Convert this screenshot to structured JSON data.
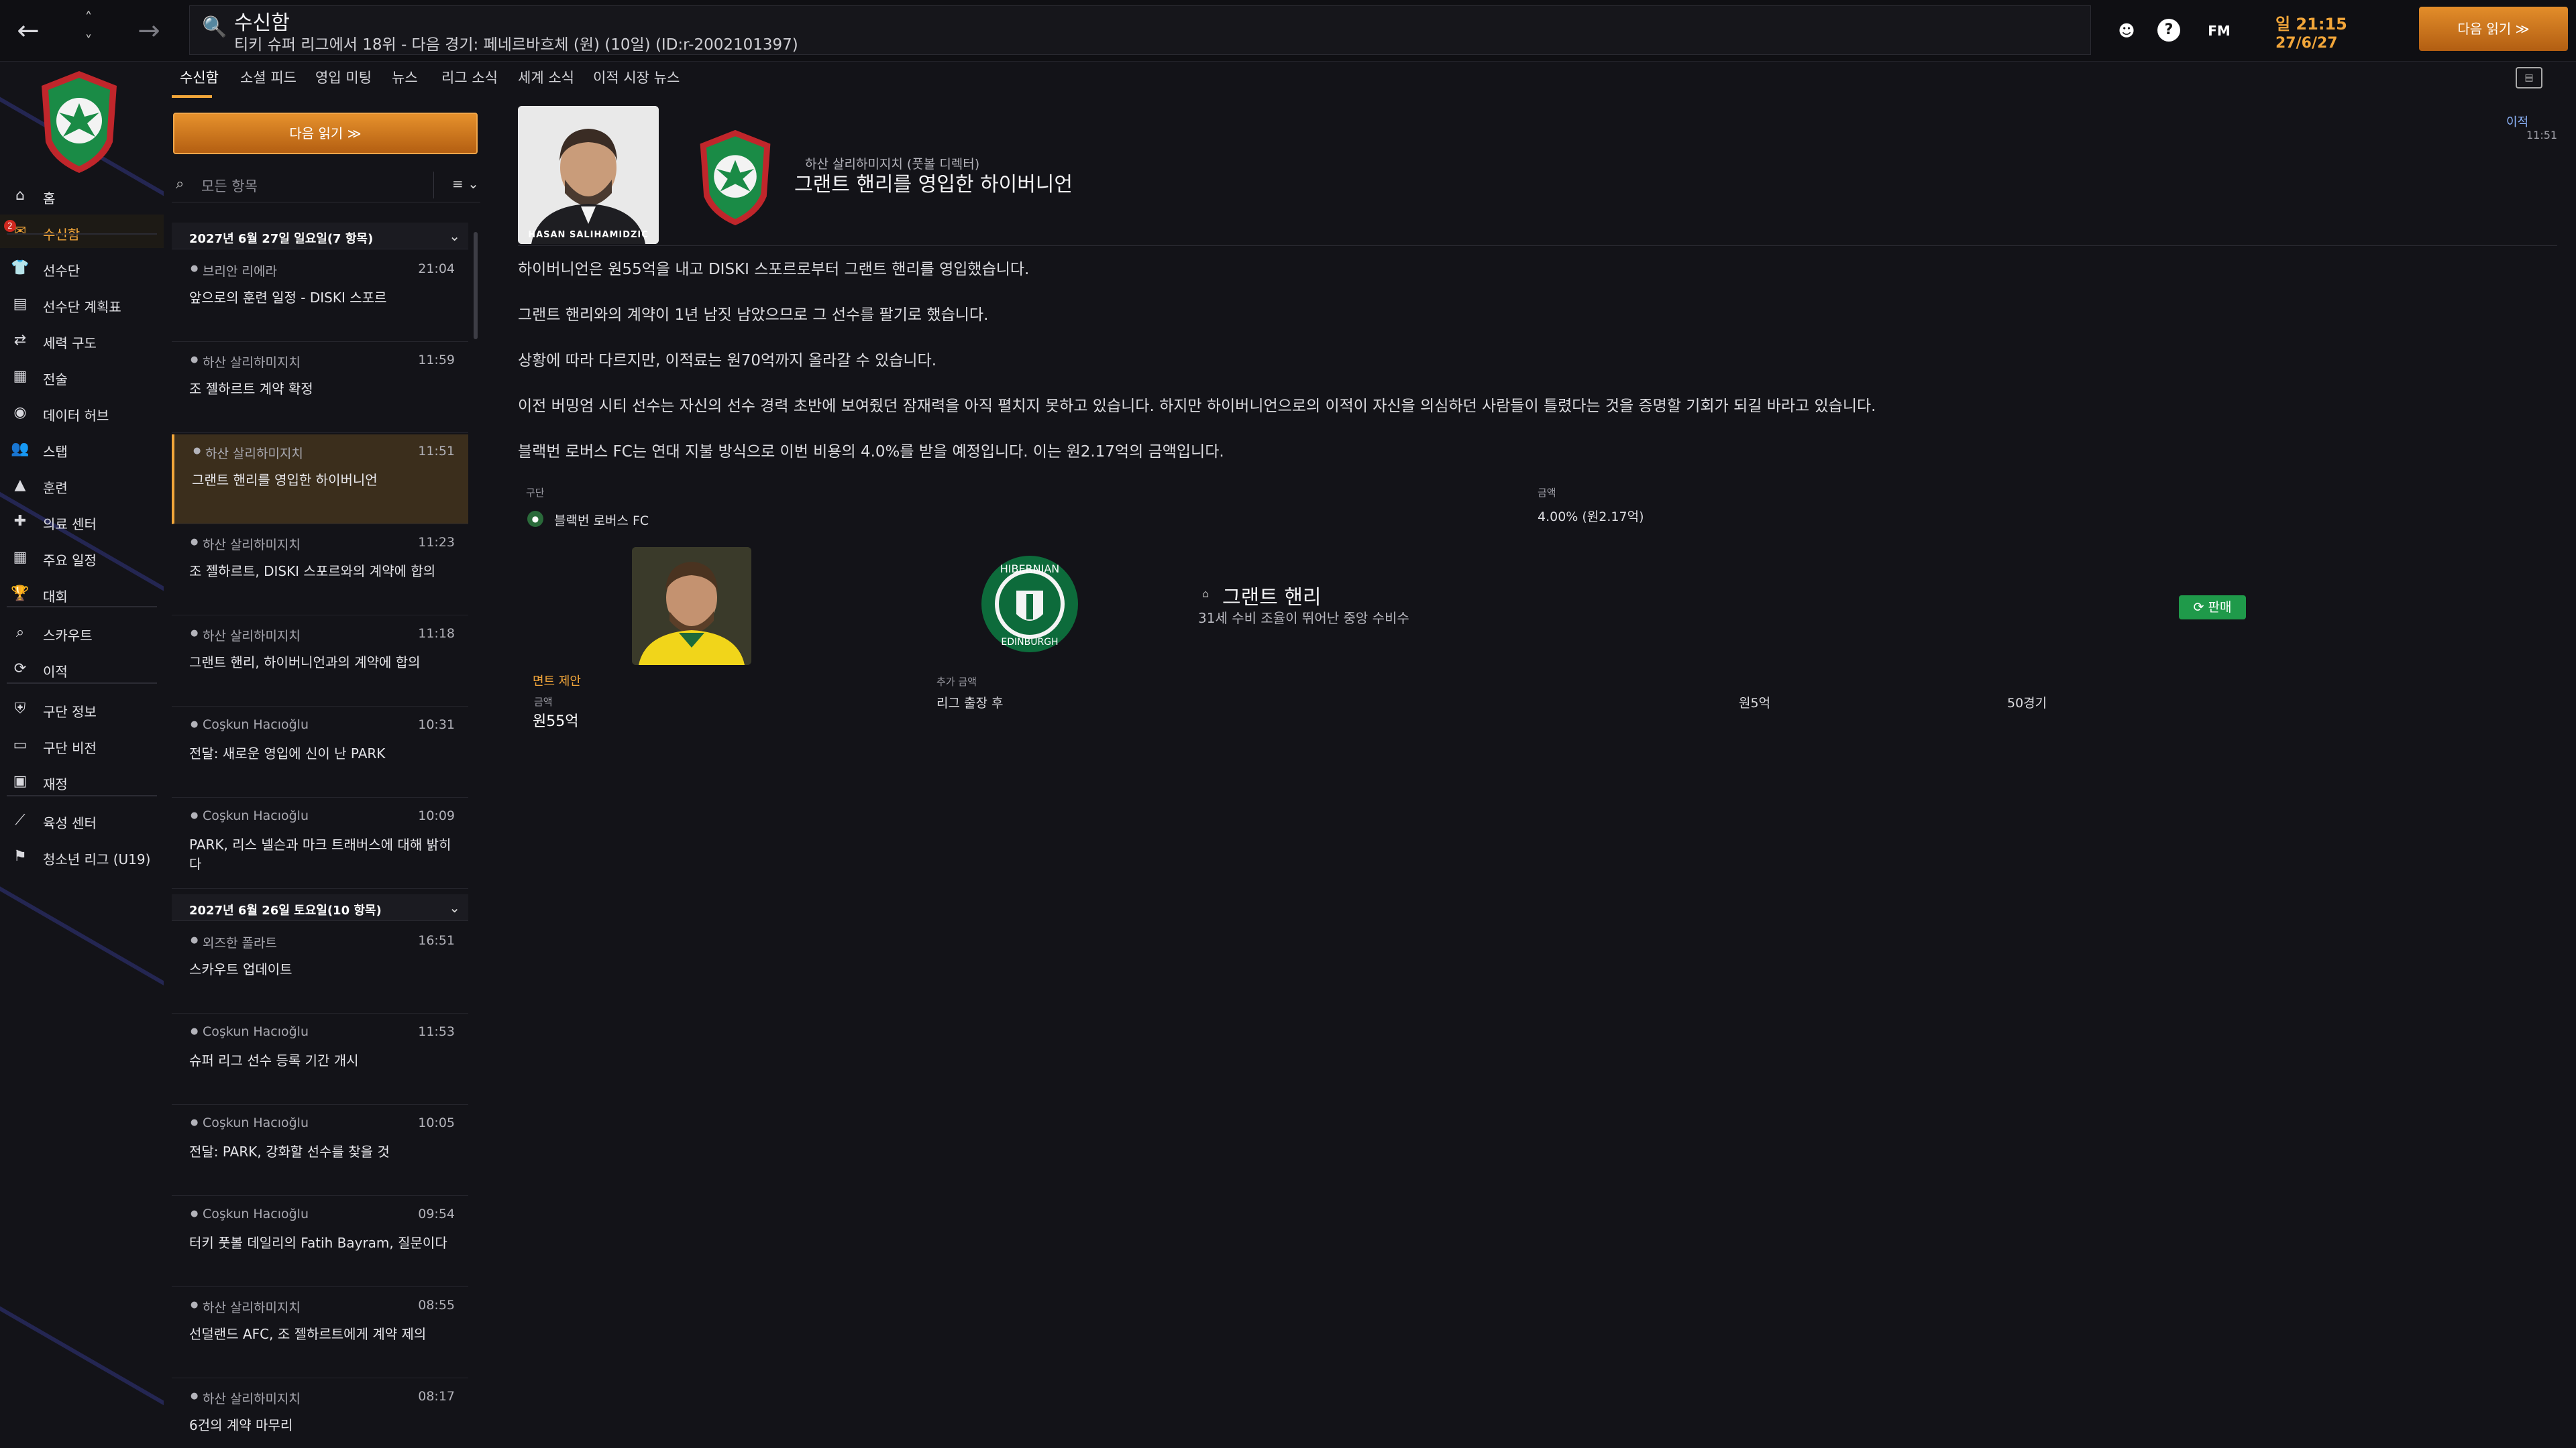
{
  "topbar": {
    "title": "수신함",
    "subtitle": "티키 슈퍼 리그에서 18위 - 다음 경기: 페네르바흐체 (원) (10일) (ID:r-2002101397)",
    "time": "일 21:15",
    "date": "27/6/27",
    "continue": "다음 읽기  ≫",
    "fm_label": "FM",
    "help_label": "?"
  },
  "sidebar": {
    "items": [
      {
        "label": "홈",
        "icon": "home-icon"
      },
      {
        "label": "수신함",
        "icon": "inbox-icon",
        "badge": "2"
      },
      {
        "label": "선수단",
        "icon": "shirt-icon"
      },
      {
        "label": "선수단 계획표",
        "icon": "clipboard-icon"
      },
      {
        "label": "세력 구도",
        "icon": "dynamics-icon"
      },
      {
        "label": "전술",
        "icon": "tactics-icon"
      },
      {
        "label": "데이터 허브",
        "icon": "data-hub-icon"
      },
      {
        "label": "스탭",
        "icon": "staff-icon"
      },
      {
        "label": "훈련",
        "icon": "training-icon"
      },
      {
        "label": "의료 센터",
        "icon": "medical-icon"
      },
      {
        "label": "주요 일정",
        "icon": "calendar-icon"
      },
      {
        "label": "대회",
        "icon": "trophy-icon"
      },
      {
        "label": "스카우트",
        "icon": "scouting-icon"
      },
      {
        "label": "이적",
        "icon": "transfers-icon"
      },
      {
        "label": "구단 정보",
        "icon": "club-info-icon"
      },
      {
        "label": "구단 비전",
        "icon": "club-vision-icon"
      },
      {
        "label": "재정",
        "icon": "finances-icon"
      },
      {
        "label": "육성 센터",
        "icon": "development-icon"
      },
      {
        "label": "청소년 리그 (U19)",
        "icon": "youth-icon"
      }
    ]
  },
  "tabs": [
    "수신함",
    "소셜 피드",
    "영입 미팅",
    "뉴스",
    "리그 소식",
    "세계 소식",
    "이적 시장 뉴스"
  ],
  "inbox": {
    "continue": "다음 읽기  ≫",
    "filter_placeholder": "모든 항목",
    "filter_menu": "≡ ⌄",
    "days": [
      {
        "header": "2027년 6월 27일 일요일(7 항목)",
        "messages": [
          {
            "from": "브리안 리에라",
            "time": "21:04",
            "subject": "앞으로의 훈련 일정 - DISKI 스포르"
          },
          {
            "from": "하산 살리하미지치",
            "time": "11:59",
            "subject": "조 젤하르트 계약 확정"
          },
          {
            "from": "하산 살리하미지치",
            "time": "11:51",
            "subject": "그랜트 핸리를 영입한 하이버니언"
          },
          {
            "from": "하산 살리하미지치",
            "time": "11:23",
            "subject": "조 젤하르트, DISKI 스포르와의 계약에 합의"
          },
          {
            "from": "하산 살리하미지치",
            "time": "11:18",
            "subject": "그랜트 핸리, 하이버니언과의 계약에 합의"
          },
          {
            "from": "Coşkun Hacıoğlu",
            "time": "10:31",
            "subject": "전달: 새로운 영입에 신이 난 PARK"
          },
          {
            "from": "Coşkun Hacıoğlu",
            "time": "10:09",
            "subject": "PARK, 리스 넬슨과 마크 트래버스에 대해 밝히다"
          }
        ]
      },
      {
        "header": "2027년 6월 26일 토요일(10 항목)",
        "messages": [
          {
            "from": "외즈한 폴라트",
            "time": "16:51",
            "subject": "스카우트 업데이트"
          },
          {
            "from": "Coşkun Hacıoğlu",
            "time": "11:53",
            "subject": "슈퍼 리그 선수 등록 기간 개시"
          },
          {
            "from": "Coşkun Hacıoğlu",
            "time": "10:05",
            "subject": "전달: PARK, 강화할 선수를 찾을 것"
          },
          {
            "from": "Coşkun Hacıoğlu",
            "time": "09:54",
            "subject": "터키 풋볼 데일리의 Fatih Bayram, 질문이다"
          },
          {
            "from": "하산 살리하미지치",
            "time": "08:55",
            "subject": "선덜랜드 AFC, 조 젤하르트에게 계약 제의"
          },
          {
            "from": "하산 살리하미지치",
            "time": "08:17",
            "subject": "6건의 계약 마무리"
          }
        ]
      }
    ]
  },
  "article": {
    "staff_name_caption": "HASAN SALIHAMIDZIC",
    "from": "하산 살리하미지치 (풋볼 디렉터)",
    "title": "그랜트 핸리를 영입한 하이버니언",
    "tag": "이적",
    "time": "11:51",
    "paragraphs": [
      "하이버니언은 원55억을 내고 DISKI 스포르로부터 그랜트 핸리를 영입했습니다.",
      "그랜트 핸리와의 계약이 1년 남짓 남았으므로 그 선수를 팔기로 했습니다.",
      "상황에 따라 다르지만, 이적료는 원70억까지 올라갈 수 있습니다.",
      "이전 버밍엄 시티 선수는 자신의 선수 경력 초반에 보여줬던 잠재력을 아직 펼치지 못하고 있습니다. 하지만 하이버니언으로의 이적이 자신을 의심하던 사람들이 틀렸다는 것을 증명할 기회가 되길 바라고 있습니다.",
      "블랙번 로버스 FC는 연대 지불 방식으로 이번 비용의 4.0%를 받을 예정입니다. 이는 원2.17억의 금액입니다."
    ],
    "finance": {
      "club_label": "구단",
      "club": "블랙번 로버스 FC",
      "amount_label": "금액",
      "amount": "4.00% (원2.17억)"
    },
    "player": {
      "name": "그랜트 핸리",
      "desc": "31세 수비 조율이 뛰어난 중앙 수비수",
      "status": "판매"
    },
    "fees": {
      "release_label": "면트 제안",
      "fee_label": "금액",
      "fee": "원55억",
      "addon_label": "추가 금액",
      "addon": "리그 출장 후",
      "addon_value": "원5억",
      "addon_games": "50경기"
    }
  },
  "colors": {
    "accent": "#f2a63a",
    "background": "#131318",
    "sale": "#1f9a4a"
  }
}
